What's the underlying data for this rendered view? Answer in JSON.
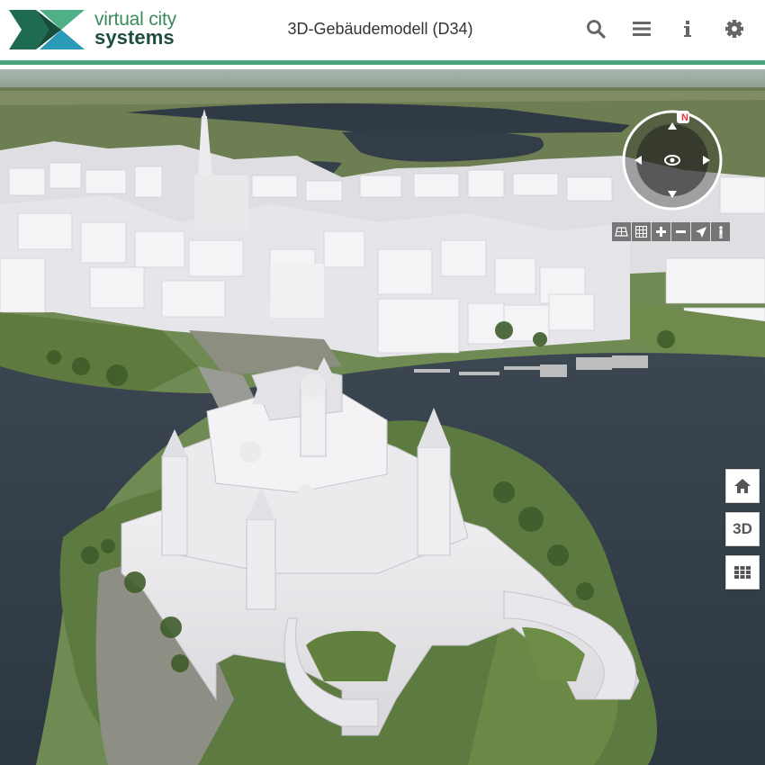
{
  "header": {
    "logo": {
      "line1": "virtual city",
      "line2": "systems"
    },
    "title": "3D-Gebäudemodell (D34)",
    "buttons": [
      {
        "name": "search",
        "icon": "search-icon"
      },
      {
        "name": "menu",
        "icon": "hamburger-menu-icon"
      },
      {
        "name": "info",
        "icon": "info-icon"
      },
      {
        "name": "settings",
        "icon": "gear-icon"
      }
    ],
    "accent_color": "#4aa37f"
  },
  "navigation": {
    "compass_north_label": "N",
    "toolbar": [
      {
        "name": "oblique-view",
        "icon": "tilt-grid-icon"
      },
      {
        "name": "grid-view",
        "icon": "grid-icon"
      },
      {
        "name": "zoom-in",
        "icon": "plus-icon"
      },
      {
        "name": "zoom-out",
        "icon": "minus-icon"
      },
      {
        "name": "locate",
        "icon": "location-arrow-icon"
      },
      {
        "name": "pedestrian",
        "icon": "pedestrian-icon"
      }
    ]
  },
  "side_buttons": {
    "home": {
      "icon": "home-icon"
    },
    "view_mode": {
      "label": "3D"
    },
    "layers": {
      "icon": "grid-dots-icon"
    }
  }
}
